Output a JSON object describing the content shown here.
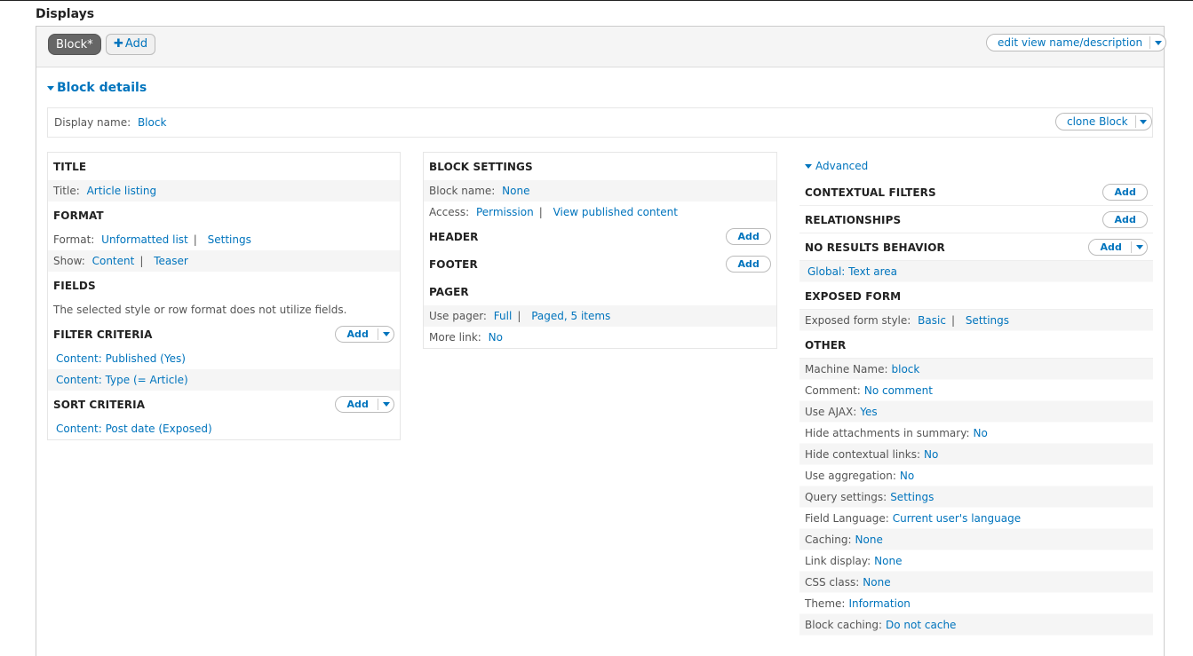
{
  "page": {
    "title": "Displays"
  },
  "tabs": {
    "active_label": "Block*",
    "add_label": "Add",
    "edit_view_label": "edit view name/description"
  },
  "details": {
    "heading": "Block details",
    "display_name_label": "Display name:",
    "display_name_value": "Block",
    "clone_label": "clone Block"
  },
  "col1": {
    "title": {
      "heading": "TITLE",
      "label": "Title:",
      "value": "Article listing"
    },
    "format": {
      "heading": "FORMAT",
      "format_label": "Format:",
      "format_value": "Unformatted list",
      "format_settings": "Settings",
      "show_label": "Show:",
      "show_value": "Content",
      "show_mode": "Teaser"
    },
    "fields": {
      "heading": "FIELDS",
      "description": "The selected style or row format does not utilize fields."
    },
    "filter": {
      "heading": "FILTER CRITERIA",
      "add_label": "Add",
      "items": [
        "Content: Published (Yes)",
        "Content: Type (= Article)"
      ]
    },
    "sort": {
      "heading": "SORT CRITERIA",
      "add_label": "Add",
      "items": [
        "Content: Post date (Exposed)"
      ]
    }
  },
  "col2": {
    "block_settings": {
      "heading": "BLOCK SETTINGS",
      "name_label": "Block name:",
      "name_value": "None",
      "access_label": "Access:",
      "access_value": "Permission",
      "access_detail": "View published content"
    },
    "header": {
      "heading": "HEADER",
      "add_label": "Add"
    },
    "footer": {
      "heading": "FOOTER",
      "add_label": "Add"
    },
    "pager": {
      "heading": "PAGER",
      "use_label": "Use pager:",
      "use_value": "Full",
      "use_detail": "Paged, 5 items",
      "more_label": "More link:",
      "more_value": "No"
    }
  },
  "col3": {
    "advanced_label": "Advanced",
    "contextual": {
      "heading": "CONTEXTUAL FILTERS",
      "add_label": "Add"
    },
    "relationships": {
      "heading": "RELATIONSHIPS",
      "add_label": "Add"
    },
    "no_results": {
      "heading": "NO RESULTS BEHAVIOR",
      "add_label": "Add",
      "items": [
        "Global: Text area"
      ]
    },
    "exposed": {
      "heading": "EXPOSED FORM",
      "label": "Exposed form style:",
      "value": "Basic",
      "settings": "Settings"
    },
    "other": {
      "heading": "OTHER",
      "rows": [
        {
          "label": "Machine Name:",
          "value": "block"
        },
        {
          "label": "Comment:",
          "value": "No comment"
        },
        {
          "label": "Use AJAX:",
          "value": "Yes"
        },
        {
          "label": "Hide attachments in summary:",
          "value": "No"
        },
        {
          "label": "Hide contextual links:",
          "value": "No"
        },
        {
          "label": "Use aggregation:",
          "value": "No"
        },
        {
          "label": "Query settings:",
          "value": "Settings"
        },
        {
          "label": "Field Language:",
          "value": "Current user's language"
        },
        {
          "label": "Caching:",
          "value": "None"
        },
        {
          "label": "Link display:",
          "value": "None"
        },
        {
          "label": "CSS class:",
          "value": "None"
        },
        {
          "label": "Theme:",
          "value": "Information"
        },
        {
          "label": "Block caching:",
          "value": "Do not cache"
        }
      ]
    }
  },
  "colors": {
    "link": "#0074bd",
    "active_tab": "#666666",
    "heading": "#222222"
  }
}
